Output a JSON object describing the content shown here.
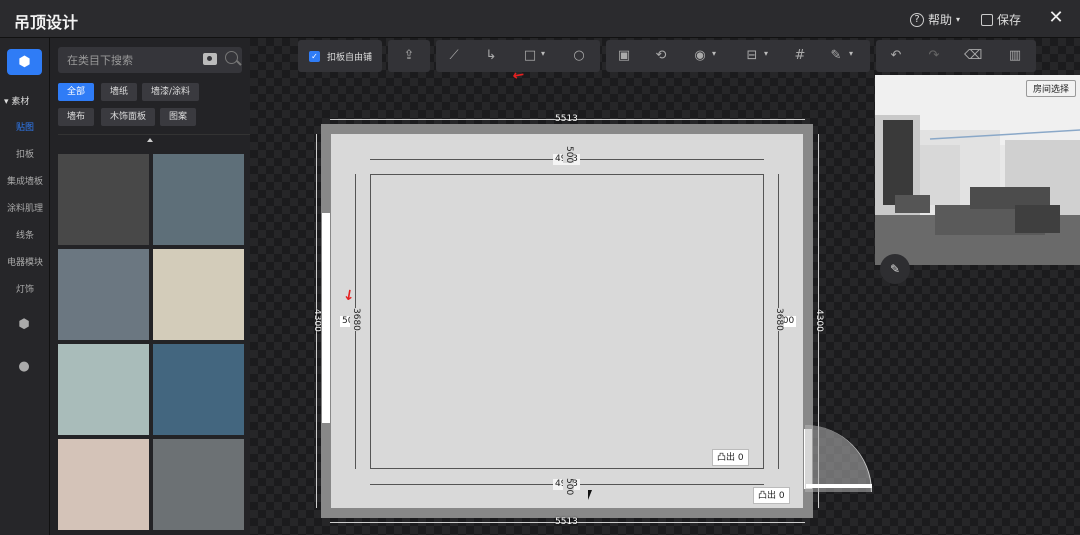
{
  "app": {
    "title": "吊顶设计"
  },
  "header": {
    "help_label": "帮助",
    "save_label": "保存",
    "close_glyph": "✕"
  },
  "leftnav": {
    "section_label": "素材",
    "items": [
      {
        "label": "贴图",
        "active": true
      },
      {
        "label": "扣板",
        "active": false
      },
      {
        "label": "集成墙板",
        "active": false
      },
      {
        "label": "涂料肌理",
        "active": false
      },
      {
        "label": "线条",
        "active": false
      },
      {
        "label": "电器模块",
        "active": false
      },
      {
        "label": "灯饰",
        "active": false
      }
    ],
    "icons": [
      "cube-icon",
      "box-icon",
      "user-icon"
    ]
  },
  "panel": {
    "search": {
      "placeholder": "在类目下搜索",
      "value": ""
    },
    "filters": [
      {
        "label": "全部",
        "active": true
      },
      {
        "label": "墙纸",
        "active": false
      },
      {
        "label": "墙漆/涂料",
        "active": false
      },
      {
        "label": "墙布",
        "active": false
      },
      {
        "label": "木饰面板",
        "active": false
      },
      {
        "label": "图案",
        "active": false
      }
    ],
    "swatches": [
      "#484848",
      "#5e6f79",
      "#6b7781",
      "#d3ccba",
      "#a9bcba",
      "#43667f",
      "#d4c3b8",
      "#6c7174"
    ]
  },
  "toolbar": {
    "checkbox_label": "扣板自由铺",
    "checkbox_checked": true,
    "tools": [
      "upload-icon",
      "line-icon",
      "curve-icon",
      "rectangle-icon",
      "circle-icon",
      "frame-icon",
      "rotate-icon",
      "eye-icon",
      "align-icon",
      "grid-icon",
      "magic-icon",
      "undo-icon",
      "redo-icon",
      "eraser-icon",
      "map-icon"
    ]
  },
  "plan": {
    "outer_width": "5513",
    "inner_width_top": "4923",
    "inner_width_bottom": "4923",
    "offset_top": "500",
    "offset_bottom": "500",
    "offset_left": "500",
    "offset_right": "500",
    "height_left": "3680",
    "height_right": "3680",
    "outer_height_left": "4300",
    "outer_height_right": "4300",
    "protrusion_label": "凸出",
    "protrusion_inner": "0",
    "protrusion_outer": "0"
  },
  "preview": {
    "room_select_label": "房间选择"
  }
}
